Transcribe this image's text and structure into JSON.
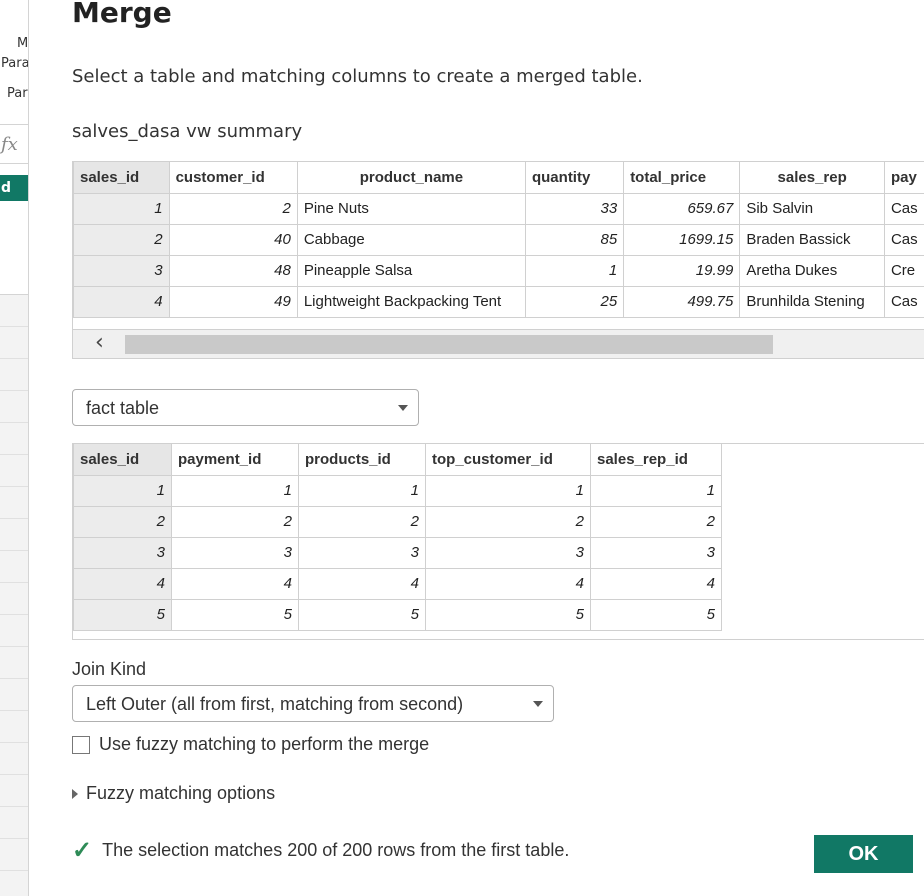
{
  "background": {
    "ribbon_lines": [
      "M",
      "Para",
      "Par"
    ],
    "formula_symbol": "fx",
    "selected_letter": "d"
  },
  "dialog": {
    "title": "Merge",
    "instruction": "Select a table and matching columns to create a merged table.",
    "first_table_name": "salves_dasa vw summary",
    "first_table": {
      "columns": [
        "sales_id",
        "customer_id",
        "product_name",
        "quantity",
        "total_price",
        "sales_rep",
        "pay"
      ],
      "rows": [
        [
          "1",
          "2",
          "Pine Nuts",
          "33",
          "659.67",
          "Sib Salvin",
          "Cas"
        ],
        [
          "2",
          "40",
          "Cabbage",
          "85",
          "1699.15",
          "Braden Bassick",
          "Cas"
        ],
        [
          "3",
          "48",
          "Pineapple Salsa",
          "1",
          "19.99",
          "Aretha Dukes",
          "Cre"
        ],
        [
          "4",
          "49",
          "Lightweight Backpacking Tent",
          "25",
          "499.75",
          "Brunhilda Stening",
          "Cas"
        ]
      ]
    },
    "second_table_select": "fact table",
    "second_table": {
      "columns": [
        "sales_id",
        "payment_id",
        "products_id",
        "top_customer_id",
        "sales_rep_id"
      ],
      "rows": [
        [
          "1",
          "1",
          "1",
          "1",
          "1"
        ],
        [
          "2",
          "2",
          "2",
          "2",
          "2"
        ],
        [
          "3",
          "3",
          "3",
          "3",
          "3"
        ],
        [
          "4",
          "4",
          "4",
          "4",
          "4"
        ],
        [
          "5",
          "5",
          "5",
          "5",
          "5"
        ]
      ]
    },
    "join_kind_label": "Join Kind",
    "join_kind_value": "Left Outer (all from first, matching from second)",
    "fuzzy_checkbox_label": "Use fuzzy matching to perform the merge",
    "fuzzy_checked": false,
    "fuzzy_options_label": "Fuzzy matching options",
    "status_text": "The selection matches 200 of 200 rows from the first table.",
    "ok_label": "OK"
  },
  "colors": {
    "accent": "#117865",
    "check": "#2e8b57"
  }
}
